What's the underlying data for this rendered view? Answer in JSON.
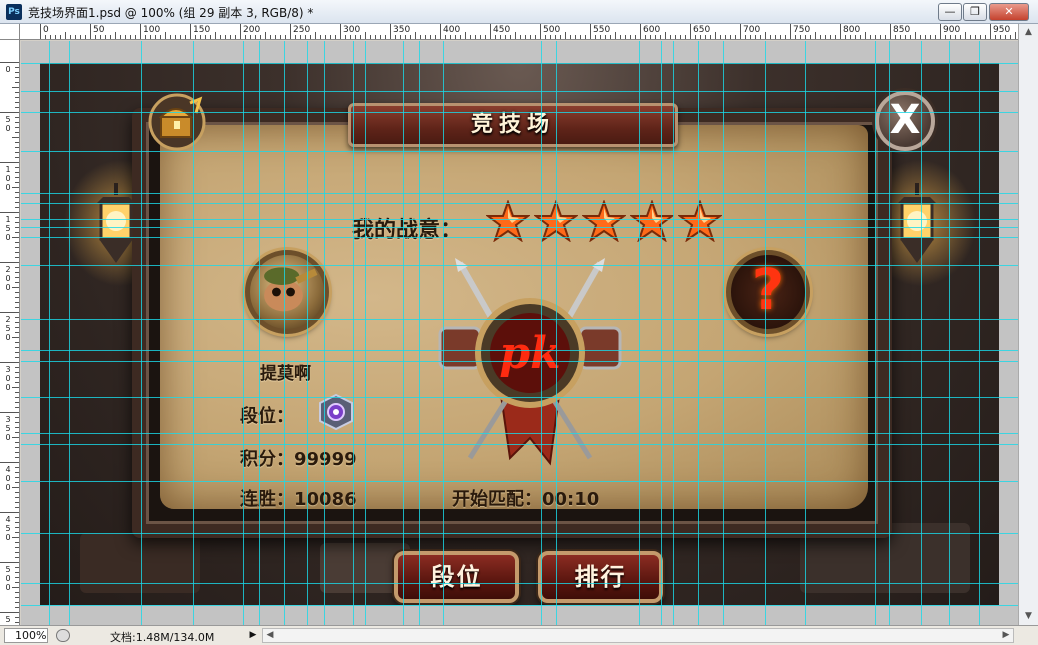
{
  "window": {
    "ps_icon": "Ps",
    "title": "竞技场界面1.psd @ 100% (组 29 副本 3, RGB/8) *",
    "minimize": "—",
    "restore": "❐",
    "close": "✕"
  },
  "ruler": {
    "h_labels": [
      "0",
      "50",
      "100",
      "150",
      "200",
      "250",
      "300",
      "350",
      "400",
      "450",
      "500",
      "550",
      "600",
      "650",
      "700",
      "750",
      "800",
      "850",
      "900",
      "950"
    ],
    "v_labels": [
      "0",
      "50",
      "100",
      "150",
      "200",
      "250",
      "300",
      "350",
      "400",
      "450",
      "500",
      "550"
    ]
  },
  "game": {
    "title": "竞技场",
    "close_symbol": "X",
    "fight_label": "我的战意：",
    "fight_stars": 5,
    "player_name": "提莫啊",
    "rank_label": "段位：",
    "score_label": "积分：99999",
    "streak_label": "连胜：10086",
    "opponent_symbol": "?",
    "pk_text": "pk",
    "match_label": "开始匹配：00:10",
    "btn_rank": "段位",
    "btn_leaderboard": "排行",
    "colors": {
      "accent_red": "#ff3410",
      "parchment": "#c4a573",
      "guide": "#1ad9e8"
    }
  },
  "status": {
    "zoom": "100%",
    "doc": "文档:1.48M/134.0M",
    "arrow": "▶"
  }
}
